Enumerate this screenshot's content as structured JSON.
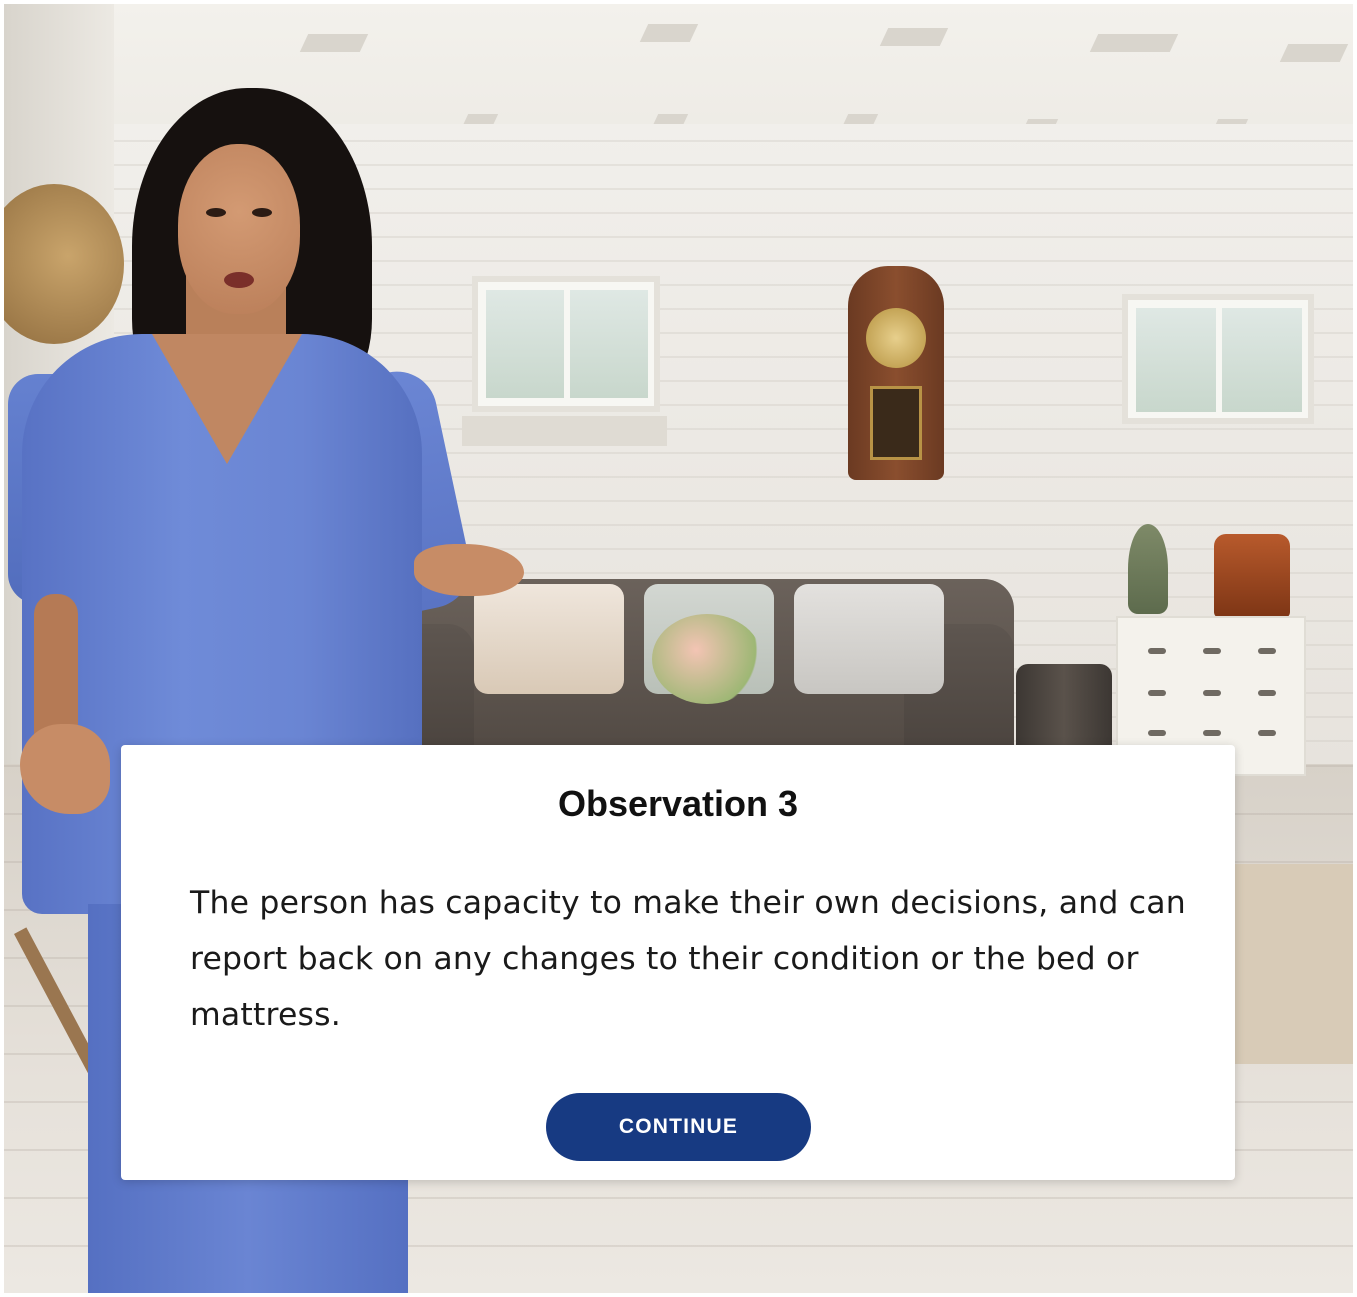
{
  "dialog": {
    "title": "Observation 3",
    "body": "The person has capacity to make their own decisions, and can report back on any changes to their condition or the bed or mattress.",
    "continue_label": "CONTINUE"
  },
  "colors": {
    "button_bg": "#173a82",
    "button_text": "#ffffff",
    "card_bg": "#ffffff",
    "title_text": "#111111",
    "body_text": "#1a1a1a",
    "scrubs": "#6a85d3"
  },
  "scene": {
    "background": "living-room-illustration",
    "character": "nurse-in-blue-scrubs"
  }
}
